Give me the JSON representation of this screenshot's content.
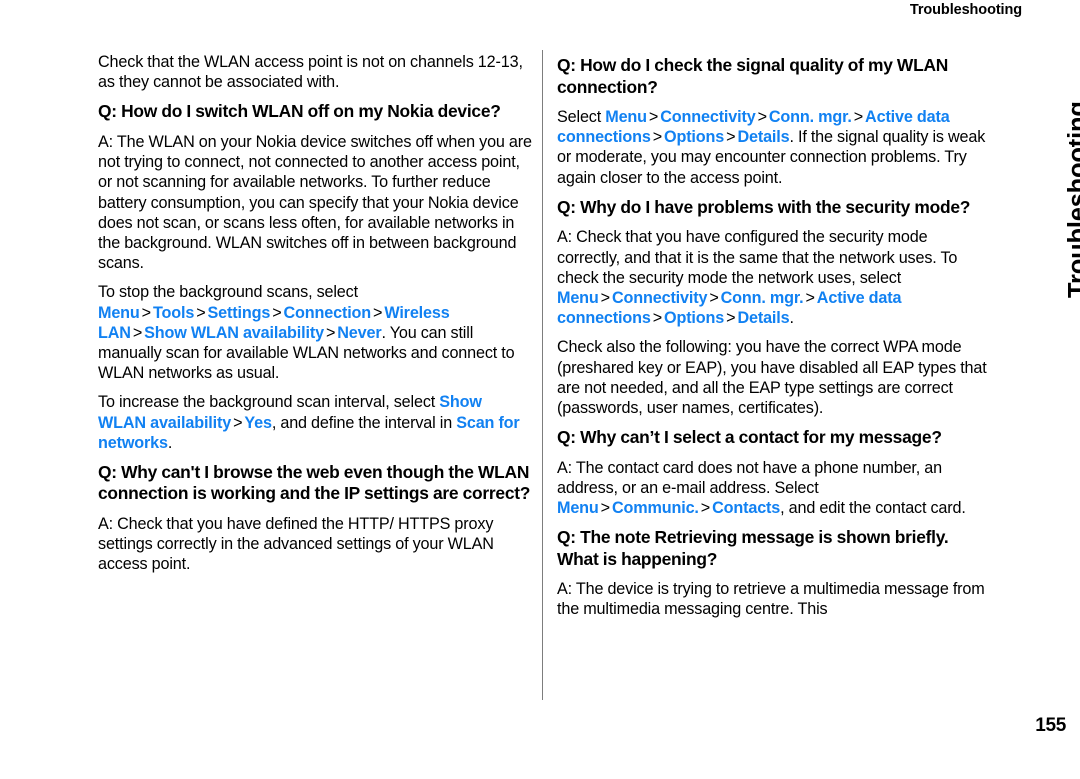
{
  "header": {
    "running_title": "Troubleshooting",
    "chapter_tab": "Troubleshooting",
    "page_number": "155"
  },
  "colors": {
    "ui_path_blue": "#1181F2",
    "text_black": "#000000",
    "divider_grey": "#7d7d7d",
    "background": "#ffffff"
  },
  "left_column": {
    "p_channels": "Check that the WLAN access point is not on channels 12-13, as they cannot be associated with.",
    "h_switch_off": "Q: How do I switch WLAN off on my Nokia device?",
    "p_switch_off_answer": "A: The WLAN on your Nokia device switches off when you are not trying to connect, not connected to another access point, or not scanning for available networks. To further reduce battery consumption, you can specify that your Nokia device does not scan, or scans less often, for available networks in the background. WLAN switches off in between background scans.",
    "p_stop_scans": {
      "lead": "To stop the background scans, select ",
      "path": [
        "Menu",
        "Tools",
        "Settings",
        "Connection",
        "Wireless LAN",
        "Show WLAN availability",
        "Never"
      ],
      "separator": ">",
      "tail": ". You can still manually scan for available WLAN networks and connect to WLAN networks as usual."
    },
    "p_increase_interval": {
      "lead": "To increase the background scan interval, select ",
      "path": [
        "Show WLAN availability",
        "Yes"
      ],
      "separator": ">",
      "mid": ", and define the interval in ",
      "path2": [
        "Scan for networks"
      ],
      "tail": "."
    },
    "h_browse_web": "Q: Why can't I browse the web even though the WLAN connection is working and the IP settings are correct?",
    "p_browse_web_answer": "A: Check that you have defined the HTTP/ HTTPS proxy settings correctly in the advanced settings of your WLAN access point."
  },
  "right_column": {
    "h_signal_quality": "Q: How do I check the signal quality of my WLAN connection?",
    "p_signal_quality_answer": {
      "lead": "Select ",
      "path": [
        "Menu",
        "Connectivity",
        "Conn. mgr.",
        "Active data connections",
        "Options",
        "Details"
      ],
      "separator": ">",
      "tail": ". If the signal quality is weak or moderate, you may encounter connection problems. Try again closer to the access point."
    },
    "h_security_mode": "Q: Why do I have problems with the security mode?",
    "p_security_mode_answer": {
      "lead": "A: Check that you have configured the security mode correctly, and that it is the same that the network uses. To check the security mode the network uses, select ",
      "path": [
        "Menu",
        "Connectivity",
        "Conn. mgr.",
        "Active data connections",
        "Options",
        "Details"
      ],
      "separator": ">",
      "tail": "."
    },
    "p_check_also": "Check also the following: you have the correct WPA mode (preshared key or EAP), you have disabled all EAP types that are not needed, and all the EAP type settings are correct (passwords, user names, certificates).",
    "h_select_contact": "Q: Why can’t I select a contact for my message?",
    "p_select_contact_answer": {
      "lead": "A: The contact card does not have a phone number, an address, or an e-mail address. Select ",
      "path": [
        "Menu",
        "Communic.",
        "Contacts"
      ],
      "separator": ">",
      "tail": ", and edit the contact card."
    },
    "h_retrieving_note": "Q: The note Retrieving message is shown briefly. What is happening?",
    "p_retrieving_note_answer": "A: The device is trying to retrieve a multimedia message from the multimedia messaging centre. This"
  }
}
